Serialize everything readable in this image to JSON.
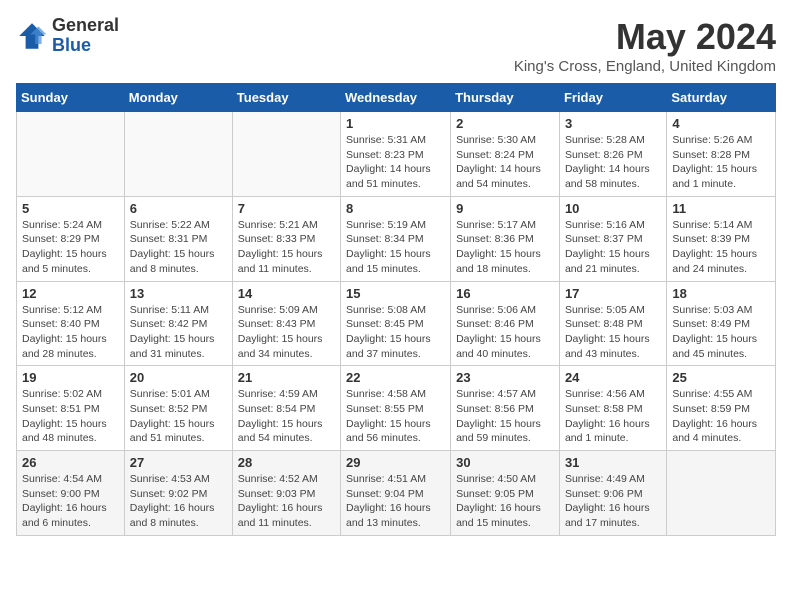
{
  "logo": {
    "general": "General",
    "blue": "Blue"
  },
  "title": "May 2024",
  "location": "King's Cross, England, United Kingdom",
  "headers": [
    "Sunday",
    "Monday",
    "Tuesday",
    "Wednesday",
    "Thursday",
    "Friday",
    "Saturday"
  ],
  "weeks": [
    [
      {
        "day": "",
        "info": ""
      },
      {
        "day": "",
        "info": ""
      },
      {
        "day": "",
        "info": ""
      },
      {
        "day": "1",
        "info": "Sunrise: 5:31 AM\nSunset: 8:23 PM\nDaylight: 14 hours\nand 51 minutes."
      },
      {
        "day": "2",
        "info": "Sunrise: 5:30 AM\nSunset: 8:24 PM\nDaylight: 14 hours\nand 54 minutes."
      },
      {
        "day": "3",
        "info": "Sunrise: 5:28 AM\nSunset: 8:26 PM\nDaylight: 14 hours\nand 58 minutes."
      },
      {
        "day": "4",
        "info": "Sunrise: 5:26 AM\nSunset: 8:28 PM\nDaylight: 15 hours\nand 1 minute."
      }
    ],
    [
      {
        "day": "5",
        "info": "Sunrise: 5:24 AM\nSunset: 8:29 PM\nDaylight: 15 hours\nand 5 minutes."
      },
      {
        "day": "6",
        "info": "Sunrise: 5:22 AM\nSunset: 8:31 PM\nDaylight: 15 hours\nand 8 minutes."
      },
      {
        "day": "7",
        "info": "Sunrise: 5:21 AM\nSunset: 8:33 PM\nDaylight: 15 hours\nand 11 minutes."
      },
      {
        "day": "8",
        "info": "Sunrise: 5:19 AM\nSunset: 8:34 PM\nDaylight: 15 hours\nand 15 minutes."
      },
      {
        "day": "9",
        "info": "Sunrise: 5:17 AM\nSunset: 8:36 PM\nDaylight: 15 hours\nand 18 minutes."
      },
      {
        "day": "10",
        "info": "Sunrise: 5:16 AM\nSunset: 8:37 PM\nDaylight: 15 hours\nand 21 minutes."
      },
      {
        "day": "11",
        "info": "Sunrise: 5:14 AM\nSunset: 8:39 PM\nDaylight: 15 hours\nand 24 minutes."
      }
    ],
    [
      {
        "day": "12",
        "info": "Sunrise: 5:12 AM\nSunset: 8:40 PM\nDaylight: 15 hours\nand 28 minutes."
      },
      {
        "day": "13",
        "info": "Sunrise: 5:11 AM\nSunset: 8:42 PM\nDaylight: 15 hours\nand 31 minutes."
      },
      {
        "day": "14",
        "info": "Sunrise: 5:09 AM\nSunset: 8:43 PM\nDaylight: 15 hours\nand 34 minutes."
      },
      {
        "day": "15",
        "info": "Sunrise: 5:08 AM\nSunset: 8:45 PM\nDaylight: 15 hours\nand 37 minutes."
      },
      {
        "day": "16",
        "info": "Sunrise: 5:06 AM\nSunset: 8:46 PM\nDaylight: 15 hours\nand 40 minutes."
      },
      {
        "day": "17",
        "info": "Sunrise: 5:05 AM\nSunset: 8:48 PM\nDaylight: 15 hours\nand 43 minutes."
      },
      {
        "day": "18",
        "info": "Sunrise: 5:03 AM\nSunset: 8:49 PM\nDaylight: 15 hours\nand 45 minutes."
      }
    ],
    [
      {
        "day": "19",
        "info": "Sunrise: 5:02 AM\nSunset: 8:51 PM\nDaylight: 15 hours\nand 48 minutes."
      },
      {
        "day": "20",
        "info": "Sunrise: 5:01 AM\nSunset: 8:52 PM\nDaylight: 15 hours\nand 51 minutes."
      },
      {
        "day": "21",
        "info": "Sunrise: 4:59 AM\nSunset: 8:54 PM\nDaylight: 15 hours\nand 54 minutes."
      },
      {
        "day": "22",
        "info": "Sunrise: 4:58 AM\nSunset: 8:55 PM\nDaylight: 15 hours\nand 56 minutes."
      },
      {
        "day": "23",
        "info": "Sunrise: 4:57 AM\nSunset: 8:56 PM\nDaylight: 15 hours\nand 59 minutes."
      },
      {
        "day": "24",
        "info": "Sunrise: 4:56 AM\nSunset: 8:58 PM\nDaylight: 16 hours\nand 1 minute."
      },
      {
        "day": "25",
        "info": "Sunrise: 4:55 AM\nSunset: 8:59 PM\nDaylight: 16 hours\nand 4 minutes."
      }
    ],
    [
      {
        "day": "26",
        "info": "Sunrise: 4:54 AM\nSunset: 9:00 PM\nDaylight: 16 hours\nand 6 minutes."
      },
      {
        "day": "27",
        "info": "Sunrise: 4:53 AM\nSunset: 9:02 PM\nDaylight: 16 hours\nand 8 minutes."
      },
      {
        "day": "28",
        "info": "Sunrise: 4:52 AM\nSunset: 9:03 PM\nDaylight: 16 hours\nand 11 minutes."
      },
      {
        "day": "29",
        "info": "Sunrise: 4:51 AM\nSunset: 9:04 PM\nDaylight: 16 hours\nand 13 minutes."
      },
      {
        "day": "30",
        "info": "Sunrise: 4:50 AM\nSunset: 9:05 PM\nDaylight: 16 hours\nand 15 minutes."
      },
      {
        "day": "31",
        "info": "Sunrise: 4:49 AM\nSunset: 9:06 PM\nDaylight: 16 hours\nand 17 minutes."
      },
      {
        "day": "",
        "info": ""
      }
    ]
  ]
}
